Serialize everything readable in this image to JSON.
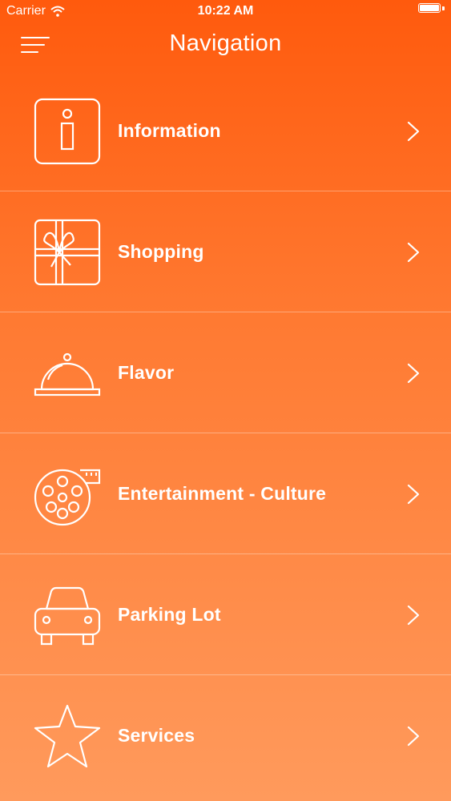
{
  "status_bar": {
    "carrier": "Carrier",
    "time": "10:22 AM",
    "wifi_icon": "wifi-icon",
    "battery_icon": "battery-icon"
  },
  "nav_bar": {
    "title": "Navigation",
    "menu_icon": "hamburger-menu-icon"
  },
  "colors": {
    "gradient_top": "#ff5a0d",
    "gradient_bottom": "#ff9a5c",
    "foreground": "#ffffff"
  },
  "menu_items": [
    {
      "label": "Information",
      "icon": "information-icon"
    },
    {
      "label": "Shopping",
      "icon": "gift-icon"
    },
    {
      "label": "Flavor",
      "icon": "food-cloche-icon"
    },
    {
      "label": "Entertainment - Culture",
      "icon": "film-reel-icon"
    },
    {
      "label": "Parking Lot",
      "icon": "car-icon"
    },
    {
      "label": "Services",
      "icon": "star-icon"
    }
  ]
}
